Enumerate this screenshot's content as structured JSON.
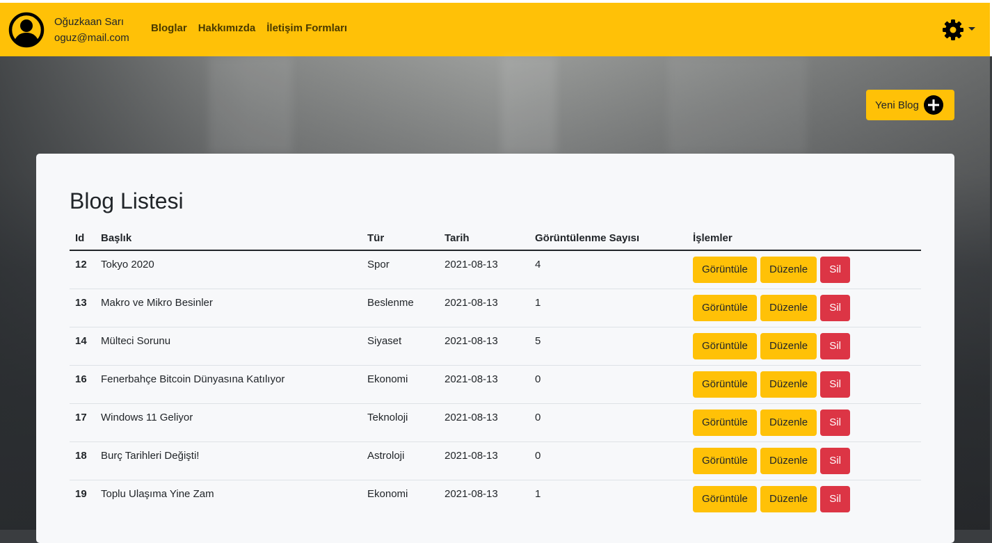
{
  "user": {
    "name": "Oğuzkaan Sarı",
    "email": "oguz@mail.com"
  },
  "nav": {
    "links": [
      "Bloglar",
      "Hakkımızda",
      "İletişim Formları"
    ]
  },
  "new_blog_label": "Yeni Blog",
  "page_title": "Blog Listesi",
  "table": {
    "headers": [
      "Id",
      "Başlık",
      "Tür",
      "Tarih",
      "Görüntülenme Sayısı",
      "İşlemler"
    ],
    "rows": [
      {
        "id": "12",
        "title": "Tokyo 2020",
        "type": "Spor",
        "date": "2021-08-13",
        "views": "4"
      },
      {
        "id": "13",
        "title": "Makro ve Mikro Besinler",
        "type": "Beslenme",
        "date": "2021-08-13",
        "views": "1"
      },
      {
        "id": "14",
        "title": "Mülteci Sorunu",
        "type": "Siyaset",
        "date": "2021-08-13",
        "views": "5"
      },
      {
        "id": "16",
        "title": "Fenerbahçe Bitcoin Dünyasına Katılıyor",
        "type": "Ekonomi",
        "date": "2021-08-13",
        "views": "0"
      },
      {
        "id": "17",
        "title": "Windows 11 Geliyor",
        "type": "Teknoloji",
        "date": "2021-08-13",
        "views": "0"
      },
      {
        "id": "18",
        "title": "Burç Tarihleri Değişti!",
        "type": "Astroloji",
        "date": "2021-08-13",
        "views": "0"
      },
      {
        "id": "19",
        "title": "Toplu Ulaşıma Yine Zam",
        "type": "Ekonomi",
        "date": "2021-08-13",
        "views": "1"
      }
    ],
    "actions": {
      "view": "Görüntüle",
      "edit": "Düzenle",
      "delete": "Sil"
    }
  },
  "colors": {
    "accent": "#ffc107",
    "danger": "#dc3545"
  }
}
